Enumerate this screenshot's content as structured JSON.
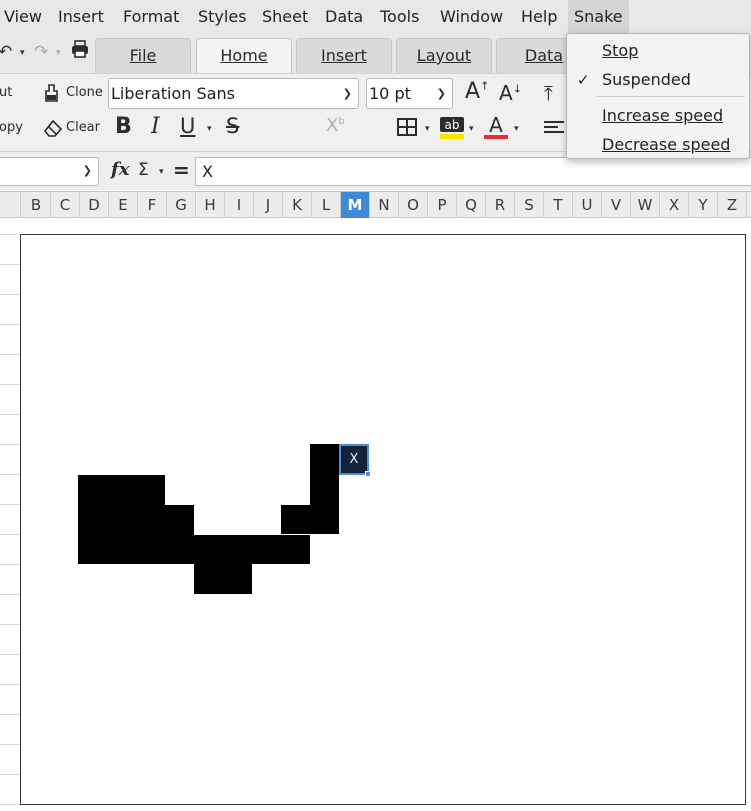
{
  "menubar": {
    "items": [
      "View",
      "Insert",
      "Format",
      "Styles",
      "Sheet",
      "Data",
      "Tools",
      "Window",
      "Help",
      "Snake"
    ]
  },
  "tabs": [
    "File",
    "Home",
    "Insert",
    "Layout",
    "Data"
  ],
  "active_tab": "Home",
  "toolbar": {
    "cut_partial": "ut",
    "copy_partial": "opy",
    "clone_label": "Clone",
    "clear_label": "Clear",
    "font_name": "Liberation Sans",
    "font_size": "10 pt"
  },
  "formula": {
    "name_box": "",
    "content": "X"
  },
  "columns": [
    "B",
    "C",
    "D",
    "E",
    "F",
    "G",
    "H",
    "I",
    "J",
    "K",
    "L",
    "M",
    "N",
    "O",
    "P",
    "Q",
    "R",
    "S",
    "T",
    "U",
    "V",
    "W",
    "X",
    "Y",
    "Z"
  ],
  "selected_column": "M",
  "game": {
    "head_label": "X"
  },
  "snake_menu": {
    "items": [
      {
        "label": "Stop",
        "checked": false
      },
      {
        "label": "Suspended",
        "checked": true
      },
      {
        "label": "Increase speed",
        "checked": false
      },
      {
        "label": "Decrease speed",
        "checked": false
      }
    ]
  },
  "colors": {
    "selected_column_bg": "#3f8ad7",
    "snake_body": "#000000",
    "snake_head_bg": "#14223a",
    "highlight_yellow": "#f5e400",
    "font_color_red": "#e03030"
  }
}
